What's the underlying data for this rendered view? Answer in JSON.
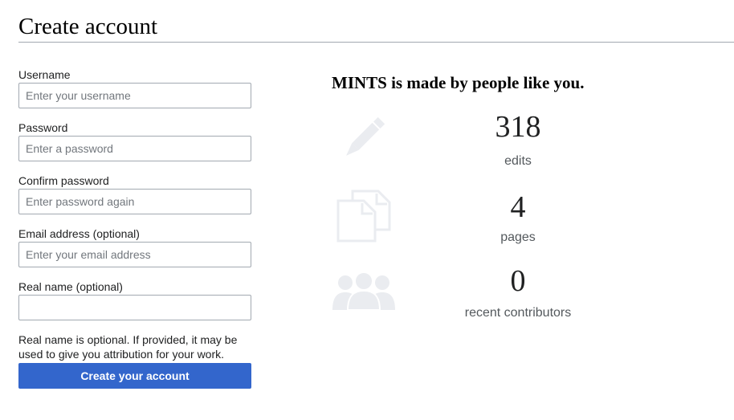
{
  "page": {
    "title": "Create account"
  },
  "form": {
    "username": {
      "label": "Username",
      "placeholder": "Enter your username",
      "value": ""
    },
    "password": {
      "label": "Password",
      "placeholder": "Enter a password",
      "value": ""
    },
    "confirm_password": {
      "label": "Confirm password",
      "placeholder": "Enter password again",
      "value": ""
    },
    "email": {
      "label": "Email address (optional)",
      "placeholder": "Enter your email address",
      "value": ""
    },
    "real_name": {
      "label": "Real name (optional)",
      "placeholder": "",
      "value": ""
    },
    "help_text": "Real name is optional. If provided, it may be used to give you attribution for your work.",
    "submit_label": "Create your account"
  },
  "stats": {
    "heading": "MINTS is made by people like you.",
    "items": [
      {
        "icon": "pencil-icon",
        "value": "318",
        "label": "edits"
      },
      {
        "icon": "pages-icon",
        "value": "4",
        "label": "pages"
      },
      {
        "icon": "people-icon",
        "value": "0",
        "label": "recent contributors"
      }
    ]
  },
  "colors": {
    "primary_button": "#3366cc",
    "icon_gray": "#eaecf0",
    "rule": "#a2a9b1"
  }
}
